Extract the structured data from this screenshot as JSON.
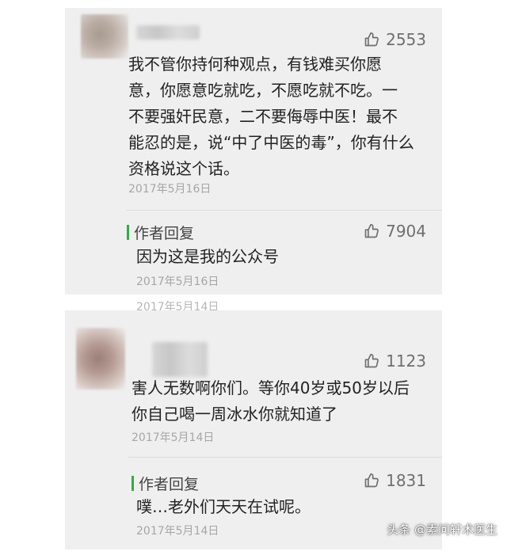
{
  "comments": [
    {
      "likes": "2553",
      "lines": [
        "我不管你持何种观点，有钱难买你愿",
        "意，你愿意吃就吃，不愿吃就不吃。一",
        "不要强奸民意，二不要侮辱中医！最不",
        "能忍的是，说“中了中医的毒”，你有什么",
        "资格说这个话。"
      ],
      "date": "2017年5月16日",
      "reply": {
        "tag": "作者回复",
        "likes": "7904",
        "text": "因为这是我的公众号",
        "date": "2017年5月16日"
      }
    },
    {
      "likes": "1123",
      "lines": [
        "害人无数啊你们。等你40岁或50岁以后",
        "你自己喝一周冰水你就知道了"
      ],
      "date": "2017年5月14日",
      "reply": {
        "tag": "作者回复",
        "likes": "1831",
        "text": "噗…老外们天天在试呢。",
        "date": "2017年5月14日"
      }
    }
  ],
  "ghost_date": "2017年5月14日",
  "watermark": "头条 @素问轩术医生"
}
